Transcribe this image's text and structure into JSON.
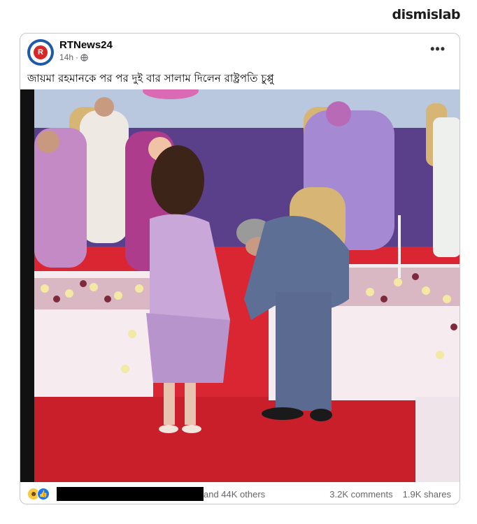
{
  "watermark": "dismislab",
  "post": {
    "page_name": "RTNews24",
    "time": "14h",
    "privacy_icon": "globe-icon",
    "text": "জায়মা রহমানকে পর পর দুই বার সালাম দিলেন রাষ্ট্রপতি চুপ্পু",
    "photo_alt": "ceremony-stage-photo",
    "reactions": [
      "haha-icon",
      "like-icon"
    ],
    "reactors_suffix": "and 44K others",
    "comments": "3.2K comments",
    "shares": "1.9K shares"
  },
  "colors": {
    "brand_blue": "#1877f2",
    "secondary_text": "#65676b",
    "stage_red": "#d92632",
    "backdrop_purple": "#5a3f8a"
  }
}
